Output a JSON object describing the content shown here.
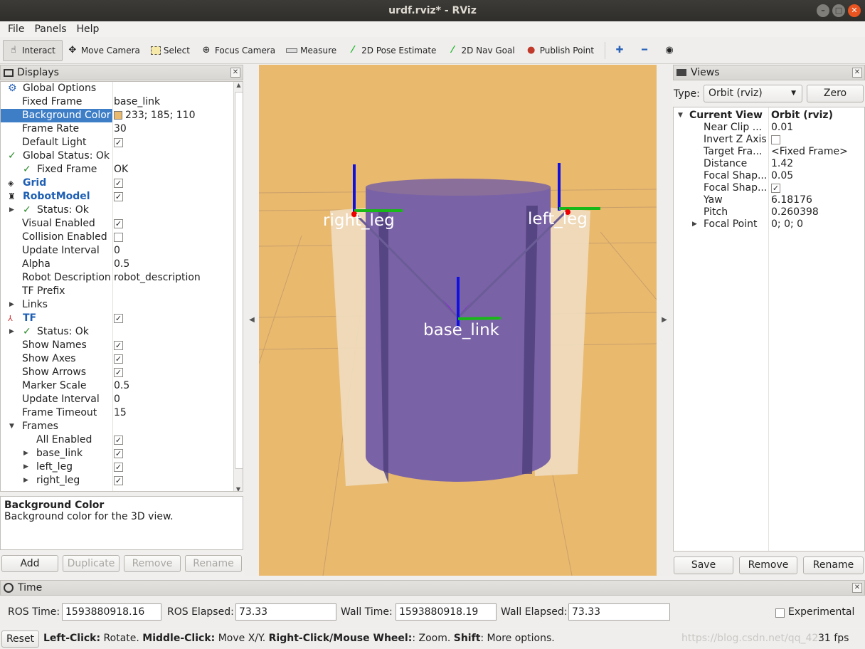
{
  "window": {
    "title": "urdf.rviz* - RViz"
  },
  "menu": [
    "File",
    "Panels",
    "Help"
  ],
  "toolbar": {
    "interact": "Interact",
    "move_camera": "Move Camera",
    "select": "Select",
    "focus_camera": "Focus Camera",
    "measure": "Measure",
    "pose_estimate": "2D Pose Estimate",
    "nav_goal": "2D Nav Goal",
    "publish_point": "Publish Point"
  },
  "displays": {
    "title": "Displays",
    "rows": [
      {
        "label": "Global Options",
        "value": ""
      },
      {
        "label": "Fixed Frame",
        "value": "base_link"
      },
      {
        "label": "Background Color",
        "value": "233; 185; 110"
      },
      {
        "label": "Frame Rate",
        "value": "30"
      },
      {
        "label": "Default Light",
        "value": ""
      },
      {
        "label": "Global Status: Ok",
        "value": ""
      },
      {
        "label": "Fixed Frame",
        "value": "OK"
      },
      {
        "label": "Grid",
        "value": ""
      },
      {
        "label": "RobotModel",
        "value": ""
      },
      {
        "label": "Status: Ok",
        "value": ""
      },
      {
        "label": "Visual Enabled",
        "value": ""
      },
      {
        "label": "Collision Enabled",
        "value": ""
      },
      {
        "label": "Update Interval",
        "value": "0"
      },
      {
        "label": "Alpha",
        "value": "0.5"
      },
      {
        "label": "Robot Description",
        "value": "robot_description"
      },
      {
        "label": "TF Prefix",
        "value": ""
      },
      {
        "label": "Links",
        "value": ""
      },
      {
        "label": "TF",
        "value": ""
      },
      {
        "label": "Status: Ok",
        "value": ""
      },
      {
        "label": "Show Names",
        "value": ""
      },
      {
        "label": "Show Axes",
        "value": ""
      },
      {
        "label": "Show Arrows",
        "value": ""
      },
      {
        "label": "Marker Scale",
        "value": "0.5"
      },
      {
        "label": "Update Interval",
        "value": "0"
      },
      {
        "label": "Frame Timeout",
        "value": "15"
      },
      {
        "label": "Frames",
        "value": ""
      },
      {
        "label": "All Enabled",
        "value": ""
      },
      {
        "label": "base_link",
        "value": ""
      },
      {
        "label": "left_leg",
        "value": ""
      },
      {
        "label": "right_leg",
        "value": ""
      }
    ],
    "desc_title": "Background Color",
    "desc_text": "Background color for the 3D view.",
    "buttons": {
      "add": "Add",
      "duplicate": "Duplicate",
      "remove": "Remove",
      "rename": "Rename"
    },
    "bg_swatch": "#e9b96e"
  },
  "scene": {
    "labels": {
      "right": "right_leg",
      "left": "left_leg",
      "base": "base_link"
    },
    "background": "#e9b96e"
  },
  "views": {
    "title": "Views",
    "type_label": "Type:",
    "type_value": "Orbit (rviz)",
    "zero": "Zero",
    "rows": [
      {
        "label": "Current View",
        "value": "Orbit (rviz)"
      },
      {
        "label": "Near Clip ...",
        "value": "0.01"
      },
      {
        "label": "Invert Z Axis",
        "value": ""
      },
      {
        "label": "Target Fra...",
        "value": "<Fixed Frame>"
      },
      {
        "label": "Distance",
        "value": "1.42"
      },
      {
        "label": "Focal Shap...",
        "value": "0.05"
      },
      {
        "label": "Focal Shap...",
        "value": ""
      },
      {
        "label": "Yaw",
        "value": "6.18176"
      },
      {
        "label": "Pitch",
        "value": "0.260398"
      },
      {
        "label": "Focal Point",
        "value": "0; 0; 0"
      }
    ],
    "buttons": {
      "save": "Save",
      "remove": "Remove",
      "rename": "Rename"
    }
  },
  "time": {
    "title": "Time",
    "ros_time_label": "ROS Time:",
    "ros_time": "1593880918.16",
    "ros_elapsed_label": "ROS Elapsed:",
    "ros_elapsed": "73.33",
    "wall_time_label": "Wall Time:",
    "wall_time": "1593880918.19",
    "wall_elapsed_label": "Wall Elapsed:",
    "wall_elapsed": "73.33",
    "experimental": "Experimental"
  },
  "status": {
    "reset": "Reset",
    "k1": "Left-Click:",
    "t1": " Rotate. ",
    "k2": "Middle-Click:",
    "t2": " Move X/Y. ",
    "k3": "Right-Click/Mouse Wheel:",
    "t3": ": Zoom. ",
    "k4": "Shift",
    "t4": ": More options.",
    "fps": "31 fps",
    "watermark": "https://blog.csdn.net/qq_42..."
  }
}
